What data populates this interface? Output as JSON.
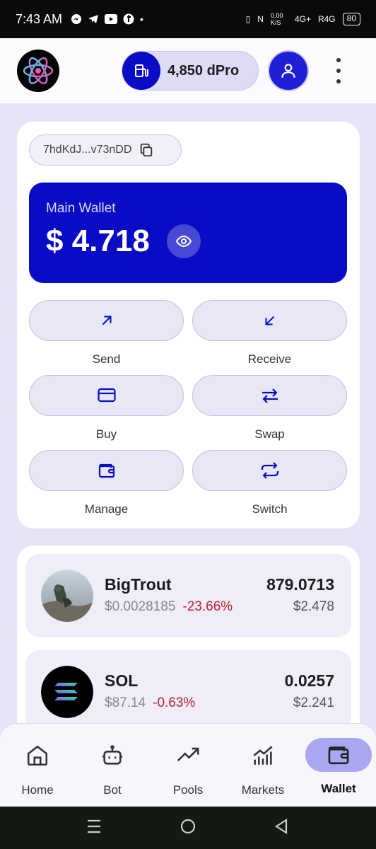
{
  "status_bar": {
    "time": "7:43 AM",
    "net_speed": "0.00 K/S",
    "network": "4G+",
    "network2": "R4G",
    "battery": "80"
  },
  "header": {
    "gas_balance": "4,850 dPro"
  },
  "wallet": {
    "address": "7hdKdJ...v73nDD",
    "label": "Main Wallet",
    "balance": "$ 4.718"
  },
  "actions": [
    {
      "label": "Send"
    },
    {
      "label": "Receive"
    },
    {
      "label": "Buy"
    },
    {
      "label": "Swap"
    },
    {
      "label": "Manage"
    },
    {
      "label": "Switch"
    }
  ],
  "tokens": [
    {
      "name": "BigTrout",
      "price": "$0.0028185",
      "change": "-23.66%",
      "amount": "879.0713",
      "value": "$2.478"
    },
    {
      "name": "SOL",
      "price": "$87.14",
      "change": "-0.63%",
      "amount": "0.0257",
      "value": "$2.241"
    }
  ],
  "nav": [
    {
      "label": "Home",
      "icon": "home-icon"
    },
    {
      "label": "Bot",
      "icon": "bot-icon"
    },
    {
      "label": "Pools",
      "icon": "trending-up-icon"
    },
    {
      "label": "Markets",
      "icon": "bar-chart-icon"
    },
    {
      "label": "Wallet",
      "icon": "wallet-icon",
      "active": true
    }
  ],
  "colors": {
    "brand": "#0a0bc4",
    "negative": "#c0202a",
    "background": "#e6e4f7"
  }
}
